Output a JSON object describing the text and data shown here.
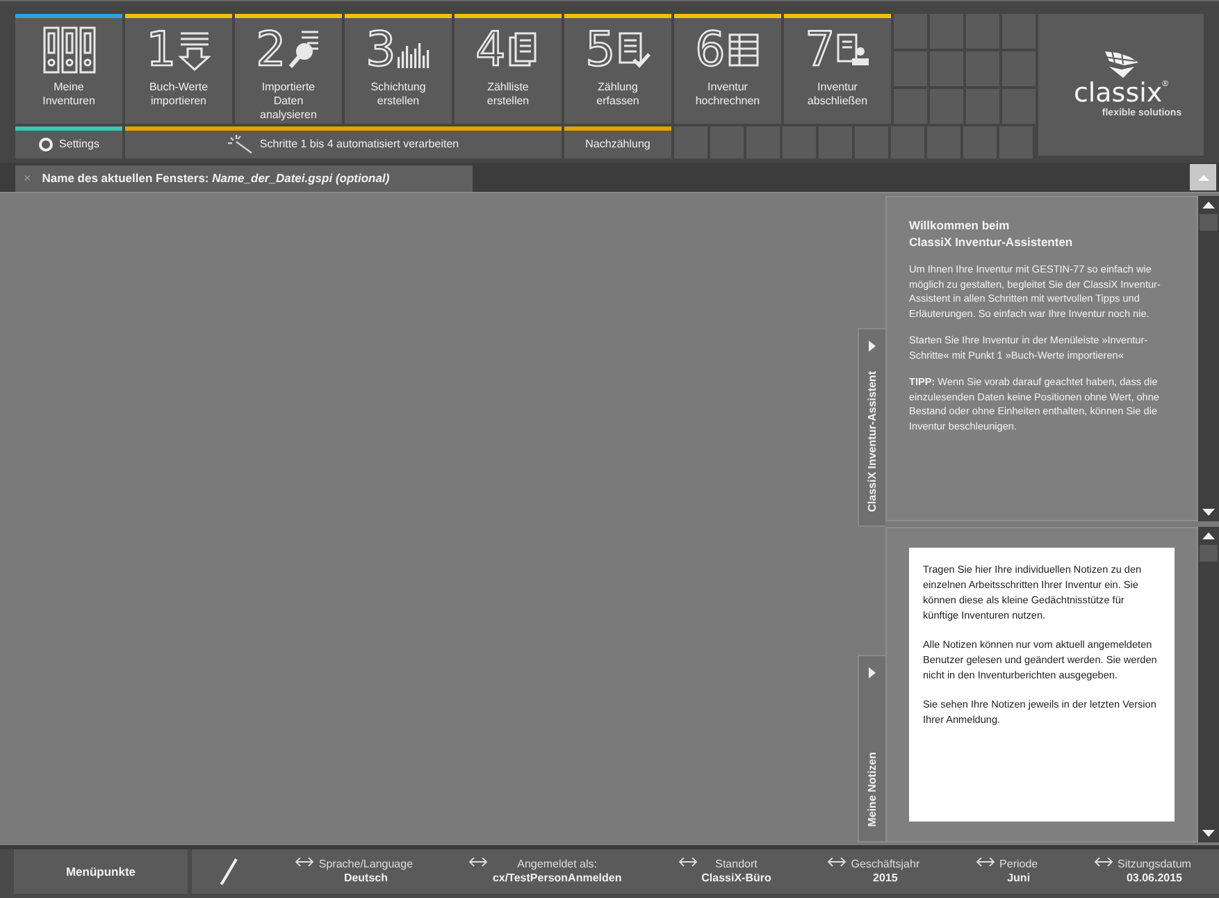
{
  "toolbar": {
    "tiles": [
      {
        "label": "Meine Inventuren",
        "kind": "binders",
        "color": "#2ba3d9"
      },
      {
        "label": "Buch-Werte importieren",
        "step": "1",
        "kind": "import",
        "color": "#f2c200"
      },
      {
        "label": "Importierte Daten analysieren",
        "step": "2",
        "kind": "analyze",
        "color": "#f2c200"
      },
      {
        "label": "Schichtung erstellen",
        "step": "3",
        "kind": "bars",
        "color": "#f2c200"
      },
      {
        "label": "Zählliste erstellen",
        "step": "4",
        "kind": "pages",
        "color": "#f2c200"
      },
      {
        "label": "Zählung erfassen",
        "step": "5",
        "kind": "check",
        "color": "#f2c200"
      },
      {
        "label": "Inventur hochrechnen",
        "step": "6",
        "kind": "table",
        "color": "#f2c200"
      },
      {
        "label": "Inventur abschließen",
        "step": "7",
        "kind": "stamp",
        "color": "#f2c200"
      }
    ],
    "actions": [
      {
        "label": "Settings",
        "kind": "settings",
        "color": "#33c9b4"
      },
      {
        "label": "Schritte 1 bis 4 automatisiert verarbeiten",
        "kind": "wand",
        "color": "#e9a000"
      },
      {
        "label": "Nachzählung",
        "kind": "plain",
        "color": "#e9a000"
      }
    ]
  },
  "logo": {
    "name": "classix",
    "mark": "®",
    "tagline": "flexible solutions"
  },
  "tab": {
    "close": "×",
    "title": "Name des aktuellen Fensters: *Name_der_Datei.gspi (optional)*"
  },
  "assistant": {
    "tab_label": "ClassiX Inventur-Assistent",
    "title": "Willkommen beim\nClassiX Inventur-Assistenten",
    "paragraphs": [
      "Um Ihnen Ihre Inventur mit GESTIN-77 so einfach wie möglich zu gestalten, begleitet Sie der ClassiX Inventur-Assistent in allen Schritten mit wertvollen Tipps und Erläuterungen. So einfach war Ihre Inventur noch nie.",
      "Starten Sie Ihre Inventur in der Menüleiste »Inventur-Schritte« mit Punkt 1 »Buch-Werte importieren«",
      "**TIPP:** Wenn Sie vorab darauf geachtet haben, dass die einzulesenden Daten keine Positionen ohne Wert, ohne Bestand oder ohne Einheiten enthalten, können Sie die Inventur beschleunigen."
    ]
  },
  "notes": {
    "tab_label": "Meine Notizen",
    "paragraphs": [
      "Tragen Sie hier Ihre individuellen Notizen zu den einzelnen Arbeitsschritten Ihrer Inventur ein. Sie können diese als kleine Gedächtnisstütze für künftige Inventuren nutzen.",
      "Alle Notizen können nur vom aktuell angemeldeten Benutzer gelesen und geändert werden. Sie werden nicht in den Inventurberichten ausgegeben.",
      "Sie sehen Ihre Notizen jeweils in der letzten Version Ihrer Anmeldung."
    ]
  },
  "status_bar": {
    "menu_button": "Menüpunkte",
    "fields": [
      {
        "label": "Sprache/Language",
        "value": "Deutsch"
      },
      {
        "label": "Angemeldet als:",
        "value": "cx/TestPersonAnmelden"
      },
      {
        "label": "Standort",
        "value": "ClassiX-Büro"
      },
      {
        "label": "Geschäftsjahr",
        "value": "2015"
      },
      {
        "label": "Periode",
        "value": "Juni"
      },
      {
        "label": "Sitzungsdatum",
        "value": "03.06.2015"
      }
    ]
  }
}
